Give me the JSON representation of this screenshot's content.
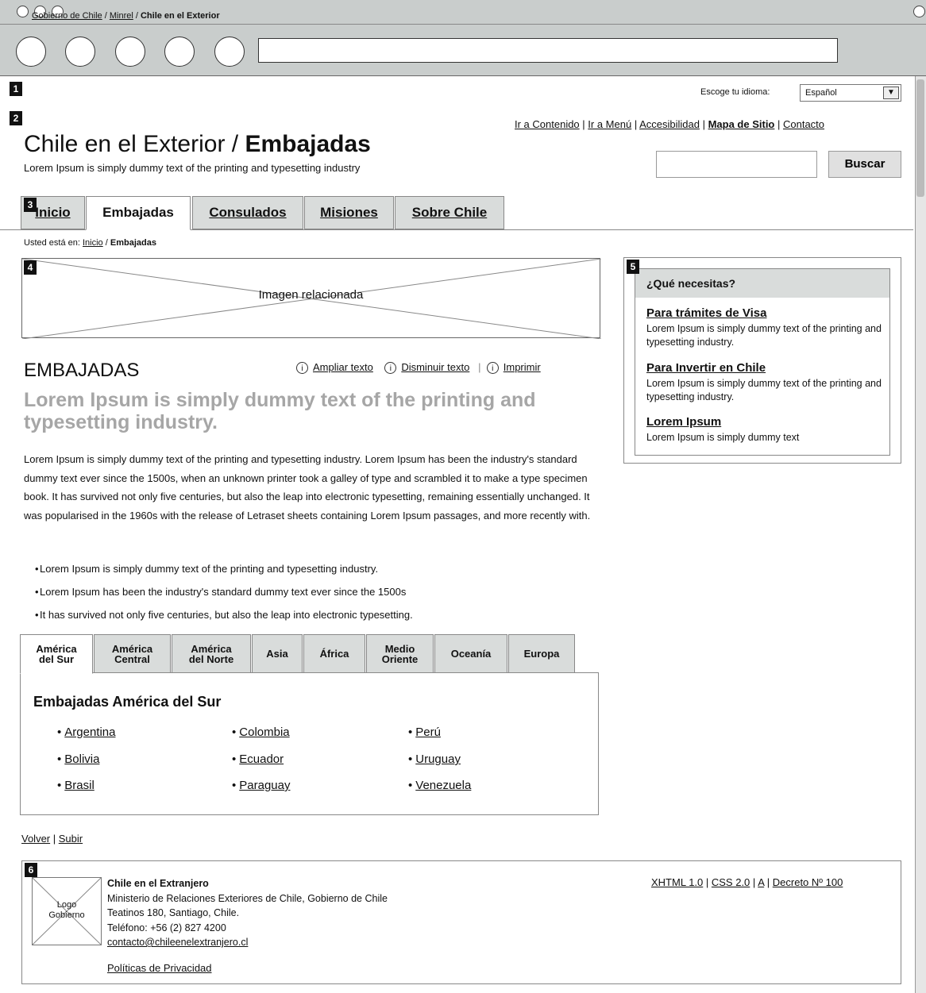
{
  "breadcrumb_top": {
    "items": [
      "Gobierno de Chile",
      "Minrel"
    ],
    "current": "Chile en el Exterior",
    "separator": " / "
  },
  "language": {
    "label": "Escoge tu idioma:",
    "selected": "Español"
  },
  "top_links": {
    "content": "Ir a Contenido",
    "menu": "Ir a Menú",
    "accessibility": "Accesibilidad",
    "sitemap": "Mapa de Sitio",
    "contact": "Contacto"
  },
  "header": {
    "title_normal": "Chile en el Exterior / ",
    "title_bold": "Embajadas",
    "subtitle": "Lorem Ipsum is simply dummy text of the printing and typesetting industry"
  },
  "search": {
    "button": "Buscar",
    "value": ""
  },
  "main_tabs": [
    "Inicio",
    "Embajadas",
    "Consulados",
    "Misiones",
    "Sobre Chile"
  ],
  "breadcrumb": {
    "label": "Usted está en:",
    "home": "Inicio",
    "current": "Embajadas"
  },
  "image": {
    "label": "Imagen relacionada"
  },
  "content": {
    "heading": "EMBAJADAS",
    "tools": [
      "Ampliar texto",
      "Disminuir texto",
      "Imprimir"
    ],
    "lead": "Lorem Ipsum is simply dummy text of the printing and typesetting industry.",
    "paragraph": "Lorem Ipsum is simply dummy text of the printing and typesetting industry. Lorem Ipsum has been the industry's standard dummy text ever since the 1500s, when an unknown printer took a galley of type and scrambled it to make a type specimen book. It has survived not only five centuries, but also the leap into electronic typesetting, remaining essentially unchanged. It was popularised in the 1960s with the release of Letraset sheets containing Lorem Ipsum passages, and more recently with.",
    "bullets": [
      "Lorem Ipsum is simply dummy text of the printing and typesetting industry.",
      "Lorem Ipsum has been the industry's standard dummy text ever since the 1500s",
      "It has survived not only five centuries, but also the leap into electronic typesetting."
    ]
  },
  "region_tabs": [
    "América\ndel Sur",
    "América\nCentral",
    "América\ndel Norte",
    "Asia",
    "África",
    "Medio\nOriente",
    "Oceanía",
    "Europa"
  ],
  "region": {
    "heading": "Embajadas América del Sur",
    "countries": [
      "Argentina",
      "Bolivia",
      "Brasil",
      "Colombia",
      "Ecuador",
      "Paraguay",
      "Perú",
      "Uruguay",
      "Venezuela"
    ]
  },
  "sidebar": {
    "title": "¿Qué necesitas?",
    "items": [
      {
        "title": "Para trámites de Visa",
        "desc": "Lorem Ipsum is simply dummy text of the printing and typesetting industry."
      },
      {
        "title": "Para Invertir en Chile",
        "desc": "Lorem Ipsum is simply dummy text of the printing and typesetting industry."
      },
      {
        "title": "Lorem Ipsum",
        "desc": "Lorem Ipsum is simply dummy text"
      }
    ]
  },
  "page_links": {
    "back": "Volver",
    "up": "Subir"
  },
  "footer": {
    "logo": "Logo\nGobierno",
    "org": "Chile en el Extranjero",
    "ministry": "Ministerio de Relaciones Exteriores de Chile, Gobierno de Chile",
    "address": "Teatinos 180, Santiago, Chile.",
    "phone": "Teléfono: +56 (2) 827 4200",
    "email": "contacto@chileenelextranjero.cl",
    "privacy": "Políticas de Privacidad",
    "standards": [
      "XHTML 1.0",
      "CSS 2.0",
      "A",
      "Decreto Nº 100"
    ]
  },
  "annotations": [
    "1",
    "2",
    "3",
    "4",
    "5",
    "6"
  ]
}
